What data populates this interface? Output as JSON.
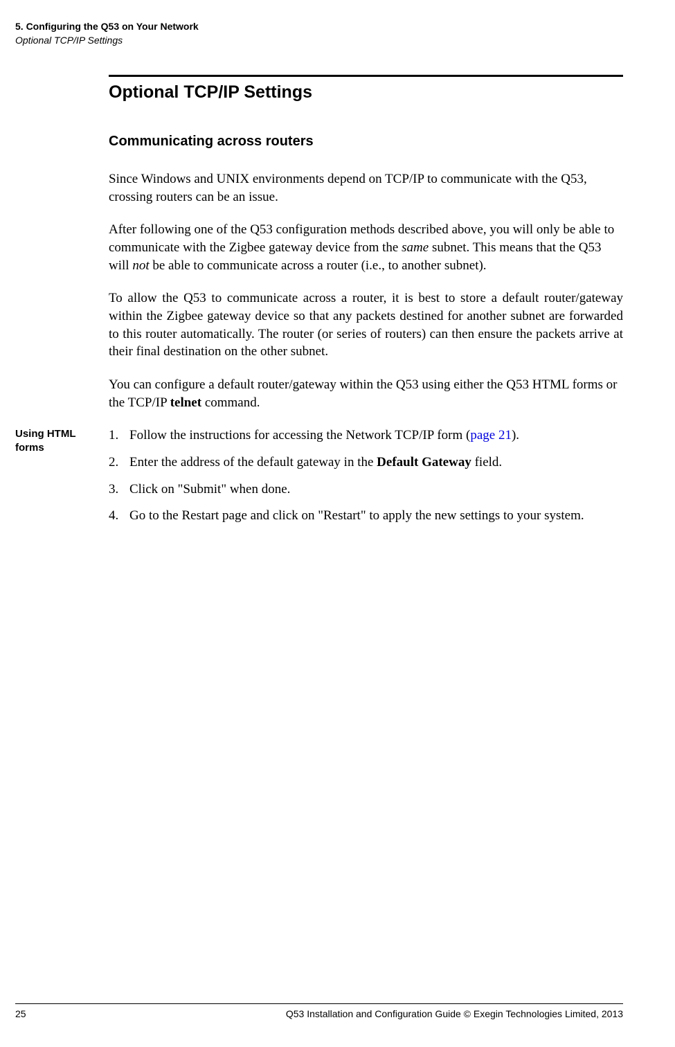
{
  "header": {
    "chapter": "5. Configuring the Q53 on Your Network",
    "section": "Optional TCP/IP Settings"
  },
  "main": {
    "title": "Optional TCP/IP Settings",
    "subsection": "Communicating across routers",
    "p1_a": "Since Windows and UNIX environments depend on TCP/IP to communicate with the Q53, crossing routers can be an issue.",
    "p2_a": "After following one of the Q53 configuration methods described above, you will only be able to communicate with the Zigbee gateway device from the ",
    "p2_same": "same",
    "p2_b": " subnet. This means that the Q53 will ",
    "p2_not": "not",
    "p2_c": " be able to communicate across a router (i.e., to another subnet).",
    "p3": "To allow the Q53 to communicate across a router, it is best to store a default router/gateway within the Zigbee gateway device so that any packets destined for another subnet are forwarded to this router automatically. The router (or series of routers) can then ensure the packets arrive at their final destination on the other subnet.",
    "p4_a": "You can configure a default router/gateway within the Q53 using either the Q53 HTML forms or the TCP/IP ",
    "p4_telnet": "telnet",
    "p4_b": " command."
  },
  "margin": {
    "note1": "Using HTML forms"
  },
  "list": {
    "n1": "1.",
    "i1_a": "Follow the instructions for accessing the Network TCP/IP form (",
    "i1_link": "page 21",
    "i1_b": ").",
    "n2": "2.",
    "i2_a": "Enter the address of the default gateway in the ",
    "i2_bold": "Default Gateway",
    "i2_b": " field.",
    "n3": "3.",
    "i3": "Click on \"Submit\" when done.",
    "n4": "4.",
    "i4": "Go to the Restart page and click on \"Restart\" to apply the new settings to your system."
  },
  "footer": {
    "page": "25",
    "right": "Q53 Installation and Configuration Guide  © Exegin Technologies Limited, 2013"
  }
}
